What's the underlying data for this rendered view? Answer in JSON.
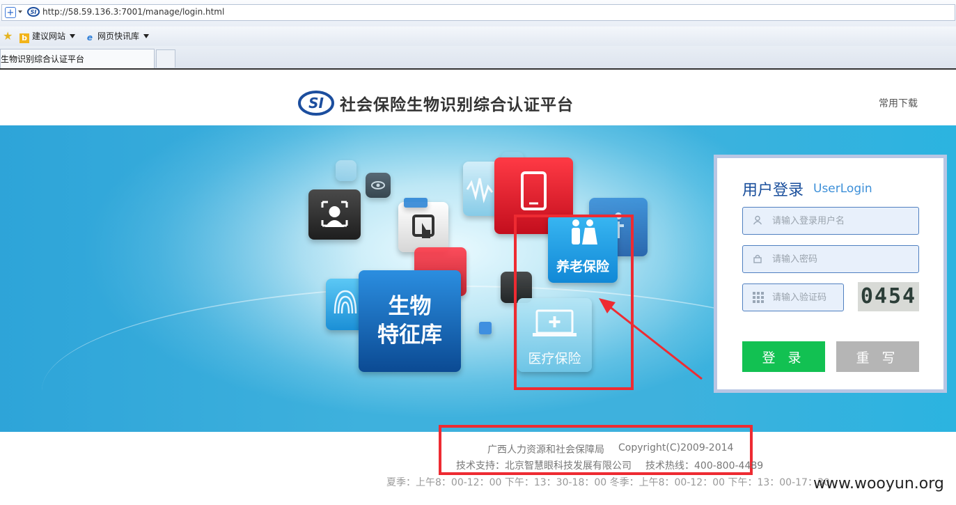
{
  "browser": {
    "url": "http://58.59.136.3:7001/manage/login.html",
    "favorites": [
      {
        "label": "建议网站"
      },
      {
        "label": "网页快讯库"
      }
    ],
    "tab_title": "生物识别综合认证平台"
  },
  "header": {
    "logo_text": "SI",
    "title": "社会保险生物识别综合认证平台",
    "downloads_link": "常用下载"
  },
  "banner": {
    "bio_tile": {
      "line1": "生物",
      "line2": "特征库"
    },
    "pension_label": "养老保险",
    "medical_label": "医疗保险"
  },
  "login": {
    "title": "用户登录",
    "subtitle": "UserLogin",
    "username_placeholder": "请输入登录用户名",
    "password_placeholder": "请输入密码",
    "captcha_placeholder": "请输入验证码",
    "captcha_code": "0454",
    "login_button": "登 录",
    "reset_button": "重 写"
  },
  "footer": {
    "org": "广西人力资源和社会保障局",
    "copyright": "Copyright(C)2009-2014",
    "support": "技术支持：北京智慧眼科技发展有限公司",
    "hotline": "技术热线：400-800-4489",
    "hours": "夏季：上午8：00-12：00 下午：13：30-18：00 冬季：上午8：00-12：00 下午：13：00-17：30",
    "watermark": "www.wooyun.org"
  },
  "colors": {
    "brand_blue": "#1a4f9c",
    "login_green": "#12c152",
    "reset_gray": "#b5b5b5",
    "highlight_red": "#ee2b32"
  }
}
